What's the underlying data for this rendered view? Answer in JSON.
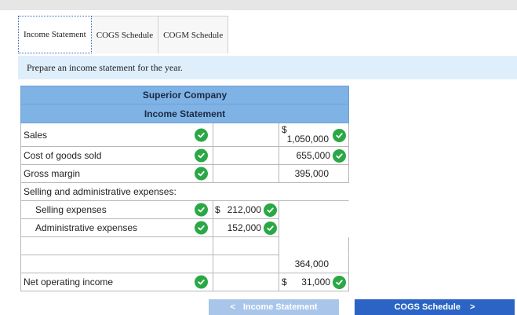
{
  "tabs": [
    {
      "label": "Income Statement"
    },
    {
      "label": "COGS Schedule"
    },
    {
      "label": "COGM Schedule"
    }
  ],
  "prompt": "Prepare an income statement for the year.",
  "statement": {
    "company": "Superior Company",
    "title": "Income Statement",
    "rows": {
      "sales": {
        "label": "Sales",
        "right_dollar": "$",
        "right_value": "1,050,000"
      },
      "cogs": {
        "label": "Cost of goods sold",
        "right_value": "655,000"
      },
      "gross_margin": {
        "label": "Gross margin",
        "right_value": "395,000"
      },
      "sga_heading": {
        "label": "Selling and administrative expenses:"
      },
      "selling": {
        "label": "Selling expenses",
        "mid_dollar": "$",
        "mid_value": "212,000"
      },
      "admin": {
        "label": "Administrative expenses",
        "mid_value": "152,000"
      },
      "total_sga": {
        "right_value": "364,000"
      },
      "net_income": {
        "label": "Net operating income",
        "right_dollar": "$",
        "right_value": "31,000"
      }
    }
  },
  "nav": {
    "prev_label": "Income Statement",
    "next_label": "COGS Schedule",
    "prev_arrow": "<",
    "next_arrow": ">"
  },
  "icons": {
    "check": "check-circle-icon"
  },
  "colors": {
    "check": "#2aa845",
    "header": "#7fb3e6",
    "next_button": "#2b64c4",
    "prev_button": "#a9c6ea",
    "prompt_bg": "#dfeefb"
  }
}
